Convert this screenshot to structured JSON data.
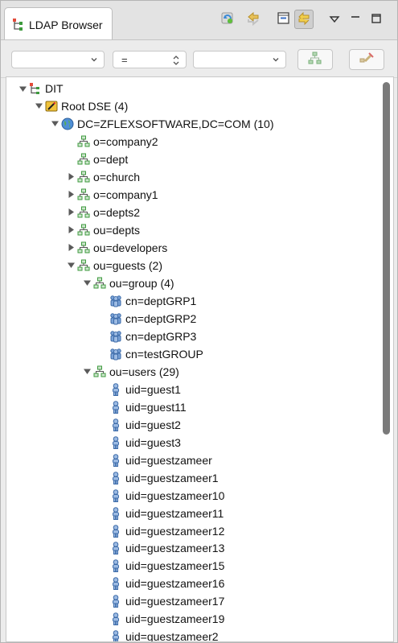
{
  "view": {
    "tab_label": "LDAP Browser",
    "toolbar_icons": [
      "refresh-icon",
      "link-sync-icon",
      "collapse-all-icon",
      "link-with-editor-icon",
      "view-menu-icon",
      "minimize-icon",
      "maximize-icon"
    ]
  },
  "filter": {
    "attribute_value": "",
    "operator_value": "=",
    "value_value": "",
    "buttons": [
      "quick-search-icon",
      "clear-search-icon"
    ]
  },
  "tree": {
    "nodes": [
      {
        "label": "DIT",
        "depth": 0,
        "expanded": true,
        "has_children": true,
        "icon": "dit-icon"
      },
      {
        "label": "Root DSE (4)",
        "depth": 1,
        "expanded": true,
        "has_children": true,
        "icon": "root-dse-icon"
      },
      {
        "label": "DC=ZFLEXSOFTWARE,DC=COM (10)",
        "depth": 2,
        "expanded": true,
        "has_children": true,
        "icon": "globe-icon"
      },
      {
        "label": "o=company2",
        "depth": 3,
        "expanded": false,
        "has_children": false,
        "icon": "entry-icon"
      },
      {
        "label": "o=dept",
        "depth": 3,
        "expanded": false,
        "has_children": false,
        "icon": "entry-icon"
      },
      {
        "label": "o=church",
        "depth": 3,
        "expanded": false,
        "has_children": true,
        "icon": "entry-icon"
      },
      {
        "label": "o=company1",
        "depth": 3,
        "expanded": false,
        "has_children": true,
        "icon": "entry-icon"
      },
      {
        "label": "o=depts2",
        "depth": 3,
        "expanded": false,
        "has_children": true,
        "icon": "entry-icon"
      },
      {
        "label": "ou=depts",
        "depth": 3,
        "expanded": false,
        "has_children": true,
        "icon": "entry-icon"
      },
      {
        "label": "ou=developers",
        "depth": 3,
        "expanded": false,
        "has_children": true,
        "icon": "entry-icon"
      },
      {
        "label": "ou=guests (2)",
        "depth": 3,
        "expanded": true,
        "has_children": true,
        "icon": "entry-icon"
      },
      {
        "label": "ou=group (4)",
        "depth": 4,
        "expanded": true,
        "has_children": true,
        "icon": "entry-icon"
      },
      {
        "label": "cn=deptGRP1",
        "depth": 5,
        "expanded": false,
        "has_children": false,
        "icon": "group-icon"
      },
      {
        "label": "cn=deptGRP2",
        "depth": 5,
        "expanded": false,
        "has_children": false,
        "icon": "group-icon"
      },
      {
        "label": "cn=deptGRP3",
        "depth": 5,
        "expanded": false,
        "has_children": false,
        "icon": "group-icon"
      },
      {
        "label": "cn=testGROUP",
        "depth": 5,
        "expanded": false,
        "has_children": false,
        "icon": "group-icon"
      },
      {
        "label": "ou=users (29)",
        "depth": 4,
        "expanded": true,
        "has_children": true,
        "icon": "entry-icon"
      },
      {
        "label": "uid=guest1",
        "depth": 5,
        "expanded": false,
        "has_children": false,
        "icon": "user-icon"
      },
      {
        "label": "uid=guest11",
        "depth": 5,
        "expanded": false,
        "has_children": false,
        "icon": "user-icon"
      },
      {
        "label": "uid=guest2",
        "depth": 5,
        "expanded": false,
        "has_children": false,
        "icon": "user-icon"
      },
      {
        "label": "uid=guest3",
        "depth": 5,
        "expanded": false,
        "has_children": false,
        "icon": "user-icon"
      },
      {
        "label": "uid=guestzameer",
        "depth": 5,
        "expanded": false,
        "has_children": false,
        "icon": "user-icon"
      },
      {
        "label": "uid=guestzameer1",
        "depth": 5,
        "expanded": false,
        "has_children": false,
        "icon": "user-icon"
      },
      {
        "label": "uid=guestzameer10",
        "depth": 5,
        "expanded": false,
        "has_children": false,
        "icon": "user-icon"
      },
      {
        "label": "uid=guestzameer11",
        "depth": 5,
        "expanded": false,
        "has_children": false,
        "icon": "user-icon"
      },
      {
        "label": "uid=guestzameer12",
        "depth": 5,
        "expanded": false,
        "has_children": false,
        "icon": "user-icon"
      },
      {
        "label": "uid=guestzameer13",
        "depth": 5,
        "expanded": false,
        "has_children": false,
        "icon": "user-icon"
      },
      {
        "label": "uid=guestzameer15",
        "depth": 5,
        "expanded": false,
        "has_children": false,
        "icon": "user-icon"
      },
      {
        "label": "uid=guestzameer16",
        "depth": 5,
        "expanded": false,
        "has_children": false,
        "icon": "user-icon"
      },
      {
        "label": "uid=guestzameer17",
        "depth": 5,
        "expanded": false,
        "has_children": false,
        "icon": "user-icon"
      },
      {
        "label": "uid=guestzameer19",
        "depth": 5,
        "expanded": false,
        "has_children": false,
        "icon": "user-icon"
      },
      {
        "label": "uid=guestzameer2",
        "depth": 5,
        "expanded": false,
        "has_children": false,
        "icon": "user-icon"
      }
    ]
  },
  "colors": {
    "entry_green": "#3d9a3d",
    "group_blue": "#4a78b8",
    "user_blue": "#7aa2d6",
    "folder_yellow": "#e7b62b",
    "twisty_gray": "#5a5a5a"
  }
}
